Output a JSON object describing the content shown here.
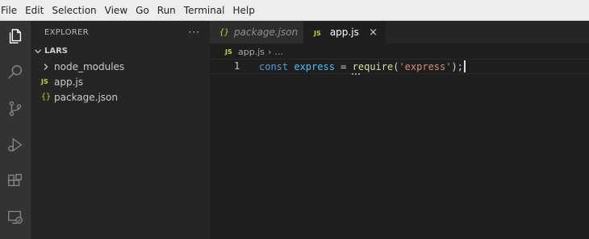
{
  "menu": [
    "File",
    "Edit",
    "Selection",
    "View",
    "Go",
    "Run",
    "Terminal",
    "Help"
  ],
  "activity_icons": [
    "explorer-icon",
    "search-icon",
    "source-control-icon",
    "run-debug-icon",
    "extensions-icon",
    "remote-explorer-icon"
  ],
  "sidebar": {
    "title": "EXPLORER",
    "more": "···",
    "root": "LARS",
    "items": [
      {
        "label": "node_modules",
        "kind": "folder"
      },
      {
        "label": "app.js",
        "kind": "js",
        "badge": "JS"
      },
      {
        "label": "package.json",
        "kind": "json",
        "badge": "{}"
      }
    ]
  },
  "tabs": [
    {
      "label": "package.json",
      "badge": "{}",
      "active": false
    },
    {
      "label": "app.js",
      "badge": "JS",
      "active": true,
      "close": "×"
    }
  ],
  "breadcrumb": {
    "badge": "JS",
    "file": "app.js",
    "sep": "›",
    "rest": "..."
  },
  "editor": {
    "line_number": "1",
    "tokens": {
      "kw": "const",
      "var": "express",
      "op": "=",
      "fn": "require",
      "open": "(",
      "str": "'express'",
      "close": ");"
    }
  },
  "colors": {
    "activity_bar": "#333333",
    "sidebar": "#252526",
    "editor": "#1e1e1e",
    "keyword": "#569cd6",
    "string": "#ce9178",
    "function": "#dcdcaa",
    "variable": "#4fc1ff",
    "badge": "#cbcb41"
  }
}
